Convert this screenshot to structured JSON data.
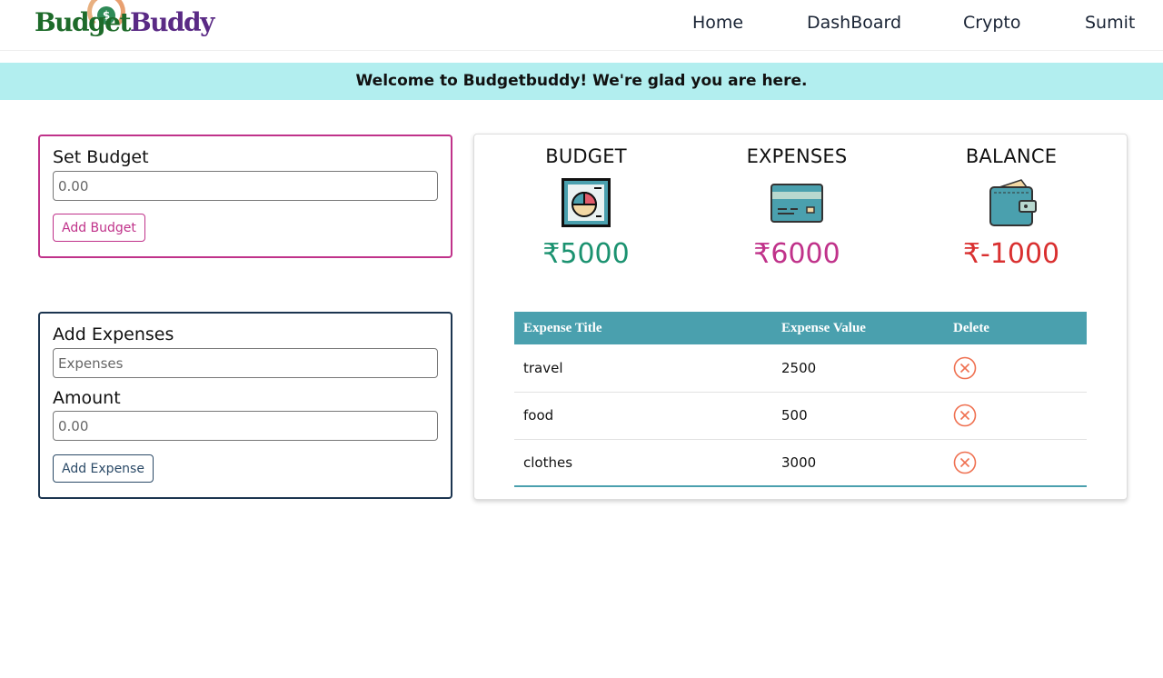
{
  "brand": {
    "part1": "Budget",
    "part2": "Buddy",
    "coin_symbol": "$"
  },
  "nav": {
    "items": [
      {
        "label": "Home"
      },
      {
        "label": "DashBoard"
      },
      {
        "label": "Crypto"
      },
      {
        "label": "Sumit"
      }
    ]
  },
  "banner": {
    "text": "Welcome to Budgetbuddy! We're glad you are here."
  },
  "budget_form": {
    "title": "Set Budget",
    "input_placeholder": "0.00",
    "button_label": "Add Budget",
    "accent_color": "#c0328a"
  },
  "expense_form": {
    "title": "Add Expenses",
    "expense_placeholder": "Expenses",
    "amount_label": "Amount",
    "amount_placeholder": "0.00",
    "button_label": "Add Expense",
    "accent_color": "#1c3550"
  },
  "summary": {
    "budget": {
      "title": "BUDGET",
      "value": "₹5000",
      "icon": "pie-chart-report-icon",
      "color": "#1b9270"
    },
    "expenses": {
      "title": "EXPENSES",
      "value": "₹6000",
      "icon": "credit-card-icon",
      "color": "#c0328a"
    },
    "balance": {
      "title": "BALANCE",
      "value": "₹-1000",
      "icon": "wallet-icon",
      "color": "#d93030"
    }
  },
  "table": {
    "headers": [
      "Expense Title",
      "Expense Value",
      "Delete"
    ],
    "header_color": "#4aa0ae",
    "rows": [
      {
        "title": "travel",
        "value": "2500"
      },
      {
        "title": "food",
        "value": "500"
      },
      {
        "title": "clothes",
        "value": "3000"
      }
    ],
    "delete_icon": "close-circle-icon"
  }
}
